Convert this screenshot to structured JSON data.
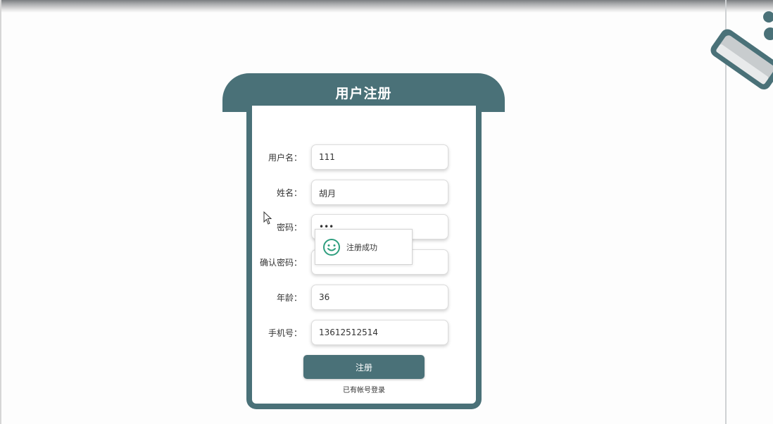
{
  "form": {
    "title": "用户注册",
    "fields": [
      {
        "label": "用户名：",
        "value": "111"
      },
      {
        "label": "姓名：",
        "value": "胡月"
      },
      {
        "label": "密码：",
        "value": "•••"
      },
      {
        "label": "确认密码：",
        "value": ""
      },
      {
        "label": "年龄：",
        "value": "36"
      },
      {
        "label": "手机号：",
        "value": "13612512514"
      }
    ],
    "register_label": "注册",
    "login_link": "已有帐号登录"
  },
  "toast": {
    "message": "注册成功",
    "icon": "smile-icon"
  },
  "colors": {
    "primary": "#4a7178",
    "toast_icon": "#2e9e7e"
  }
}
